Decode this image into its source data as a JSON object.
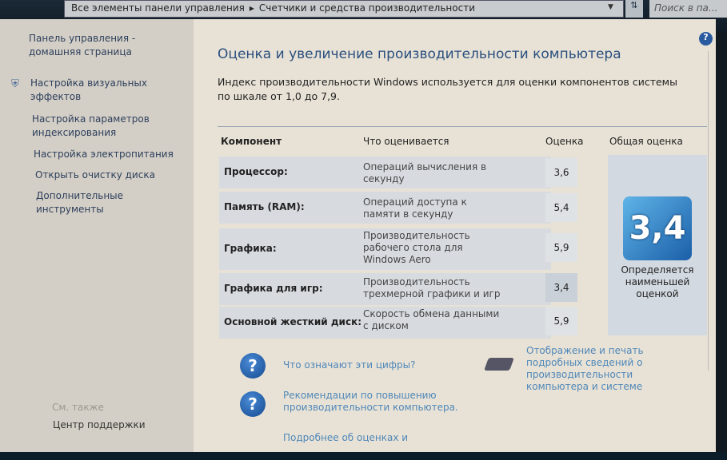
{
  "address": {
    "breadcrumb_parent": "Все элементы панели управления",
    "breadcrumb_current": "Счетчики и средства производительности",
    "search_placeholder": "Поиск в па..."
  },
  "sidebar": {
    "items": [
      {
        "label": "Панель управления - домашняя страница"
      },
      {
        "label": "Настройка визуальных эффектов"
      },
      {
        "label": "Настройка параметров индексирования"
      },
      {
        "label": "Настройка электропитания"
      },
      {
        "label": "Открыть очистку диска"
      },
      {
        "label": "Дополнительные инструменты"
      }
    ],
    "see_also": "См. также",
    "support_center": "Центр поддержки"
  },
  "main": {
    "title": "Оценка и увеличение производительности компьютера",
    "intro": "Индекс производительности Windows используется для оценки компонентов системы по шкале от 1,0 до 7,9.",
    "headers": {
      "component": "Компонент",
      "what": "Что оценивается",
      "score": "Оценка",
      "base": "Общая оценка"
    },
    "rows": [
      {
        "component": "Процессор:",
        "what": "Операций вычисления в секунду",
        "score": "3,6"
      },
      {
        "component": "Память (RAM):",
        "what": "Операций доступа к памяти в секунду",
        "score": "5,4"
      },
      {
        "component": "Графика:",
        "what": "Производительность рабочего стола для Windows Aero",
        "score": "5,9"
      },
      {
        "component": "Графика для игр:",
        "what": "Производительность трехмерной графики и игр",
        "score": "3,4"
      },
      {
        "component": "Основной жесткий диск:",
        "what": "Скорость обмена данными с диском",
        "score": "5,9"
      }
    ],
    "base_score": "3,4",
    "base_caption": "Определяется наименьшей оценкой",
    "links": {
      "what_mean": "Что означают эти цифры?",
      "print": "Отображение и печать подробных сведений о производительности компьютера и системе",
      "tips": "Рекомендации по повышению производительности компьютера.",
      "more": "Подробнее об оценках и"
    }
  }
}
